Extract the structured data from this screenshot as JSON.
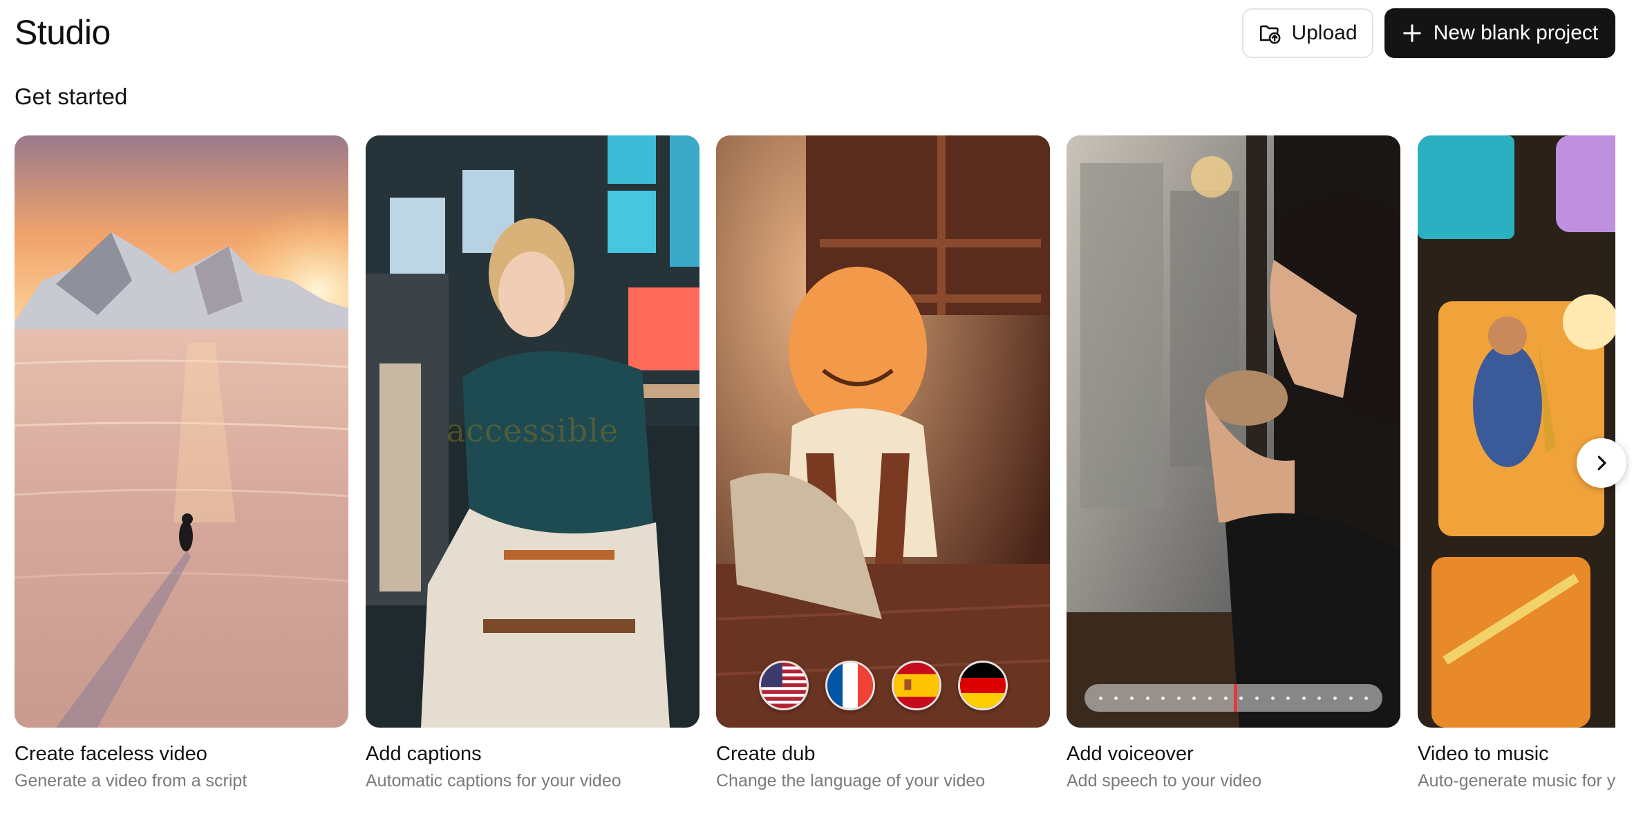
{
  "header": {
    "title": "Studio",
    "upload_label": "Upload",
    "new_project_label": "New blank project"
  },
  "section": {
    "title": "Get started"
  },
  "cards": [
    {
      "title": "Create faceless video",
      "subtitle": "Generate a video from a script",
      "image": "penguin-on-ice-at-sunset"
    },
    {
      "title": "Add captions",
      "subtitle": "Automatic captions for your video",
      "image": "woman-in-green-sweater-seated",
      "overlay_text": "accessible"
    },
    {
      "title": "Create dub",
      "subtitle": "Change the language of your video",
      "image": "animated-orange-character",
      "flags": [
        "us-flag-icon",
        "france-flag-icon",
        "spain-flag-icon",
        "germany-flag-icon"
      ]
    },
    {
      "title": "Add voiceover",
      "subtitle": "Add speech to your video",
      "image": "man-drinking-coffee-by-rainy-window",
      "timeline_progress": 0.5
    },
    {
      "title": "Video to music",
      "subtitle": "Auto-generate music for your video",
      "image": "saxophone-player-on-tv-screens"
    }
  ],
  "colors": {
    "primary_button": "#141414",
    "playhead": "#e33a3a",
    "subtitle_text": "#7a7a7a"
  }
}
